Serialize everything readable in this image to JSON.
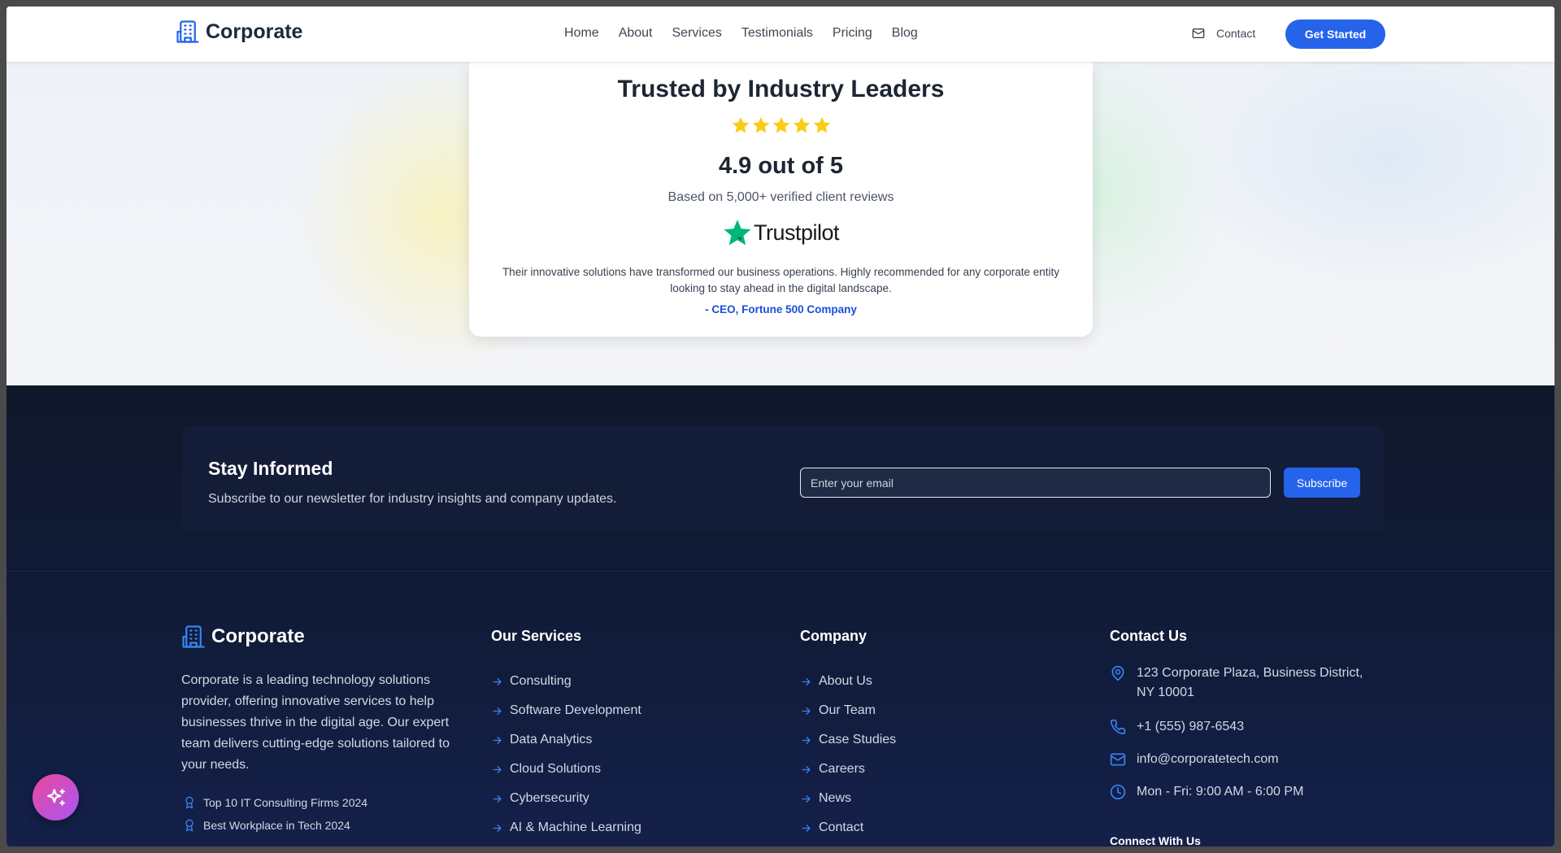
{
  "header": {
    "brand": "Corporate",
    "nav": [
      "Home",
      "About",
      "Services",
      "Testimonials",
      "Pricing",
      "Blog"
    ],
    "contact_label": "Contact",
    "cta_label": "Get Started"
  },
  "review": {
    "title": "Trusted by Industry Leaders",
    "rating_stars": 5,
    "score": "4.9 out of 5",
    "subtitle": "Based on 5,000+ verified client reviews",
    "platform": "Trustpilot",
    "quote": "Their innovative solutions have transformed our business operations. Highly recommended for any corporate entity looking to stay ahead in the digital landscape.",
    "author": "- CEO, Fortune 500 Company"
  },
  "newsletter": {
    "title": "Stay Informed",
    "subtitle": "Subscribe to our newsletter for industry insights and company updates.",
    "placeholder": "Enter your email",
    "button": "Subscribe"
  },
  "footer": {
    "brand": "Corporate",
    "description": "Corporate is a leading technology solutions provider, offering innovative services to help businesses thrive in the digital age. Our expert team delivers cutting-edge solutions tailored to your needs.",
    "awards": [
      "Top 10 IT Consulting Firms 2024",
      "Best Workplace in Tech 2024"
    ],
    "services": {
      "title": "Our Services",
      "items": [
        "Consulting",
        "Software Development",
        "Data Analytics",
        "Cloud Solutions",
        "Cybersecurity",
        "AI & Machine Learning"
      ]
    },
    "company": {
      "title": "Company",
      "items": [
        "About Us",
        "Our Team",
        "Case Studies",
        "Careers",
        "News",
        "Contact"
      ]
    },
    "contact": {
      "title": "Contact Us",
      "address": "123 Corporate Plaza, Business District, NY 10001",
      "phone": "+1 (555) 987-6543",
      "email": "info@corporatetech.com",
      "hours": "Mon - Fri: 9:00 AM - 6:00 PM",
      "connect_title": "Connect With Us"
    }
  },
  "colors": {
    "accent": "#2563eb",
    "footer_bg": "#0f172a",
    "star": "#facc15",
    "trustpilot": "#00b67a",
    "fab": "#d946ef"
  }
}
